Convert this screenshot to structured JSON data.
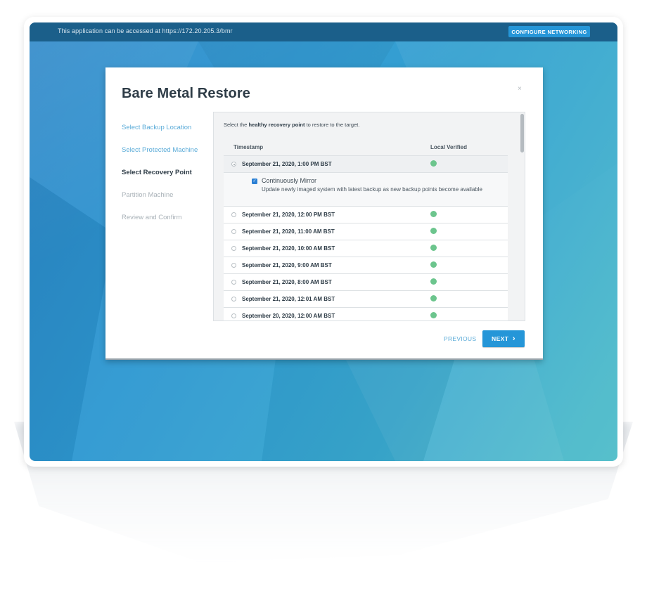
{
  "topbar": {
    "message": "This application can be accessed at https://172.20.205.3/bmr",
    "configure_label": "CONFIGURE NETWORKING"
  },
  "modal": {
    "title": "Bare Metal Restore",
    "close_label": "×",
    "steps": [
      {
        "label": "Select Backup Location",
        "state": "done"
      },
      {
        "label": "Select Protected Machine",
        "state": "done"
      },
      {
        "label": "Select Recovery Point",
        "state": "active"
      },
      {
        "label": "Partition Machine",
        "state": "pending"
      },
      {
        "label": "Review and Confirm",
        "state": "pending"
      }
    ],
    "active_step_chevron": "›",
    "instruction": {
      "prefix": "Select the ",
      "bold": "healthy recovery point",
      "suffix": " to restore to the target."
    },
    "columns": {
      "timestamp": "Timestamp",
      "verified": "Local Verified"
    },
    "recovery_points": [
      {
        "timestamp": "September 21, 2020, 1:00 PM BST",
        "selected": true
      },
      {
        "timestamp": "September 21, 2020, 12:00 PM BST",
        "selected": false
      },
      {
        "timestamp": "September 21, 2020, 11:00 AM BST",
        "selected": false
      },
      {
        "timestamp": "September 21, 2020, 10:00 AM BST",
        "selected": false
      },
      {
        "timestamp": "September 21, 2020, 9:00 AM BST",
        "selected": false
      },
      {
        "timestamp": "September 21, 2020, 8:00 AM BST",
        "selected": false
      },
      {
        "timestamp": "September 21, 2020, 12:01 AM BST",
        "selected": false
      },
      {
        "timestamp": "September 20, 2020, 12:00 AM BST",
        "selected": false
      }
    ],
    "mirror": {
      "checkbox_label": "Continuously Mirror",
      "checked": true,
      "description": "Update newly imaged system with latest backup as new backup points become available"
    },
    "previous_label": "PREVIOUS",
    "next_label": "NEXT",
    "next_chevron": "›"
  },
  "colors": {
    "topbar": "#1b5f8a",
    "accent": "#2596d8",
    "verified_dot": "#6cc58d",
    "title": "#2e3c47"
  }
}
